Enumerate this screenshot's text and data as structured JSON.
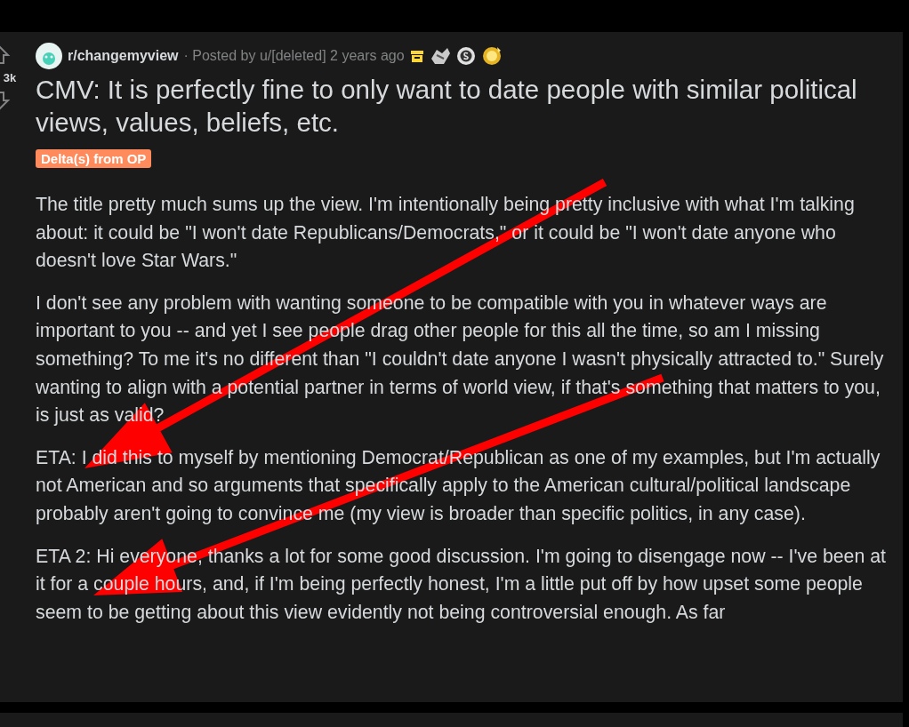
{
  "post": {
    "votes": {
      "count": "3k"
    },
    "subreddit": "r/changemyview",
    "byline": "· Posted by u/[deleted] 2 years ago",
    "awards": [
      {
        "kind": "archived"
      },
      {
        "kind": "handshake"
      },
      {
        "kind": "silver"
      },
      {
        "kind": "gold"
      }
    ],
    "title": "CMV: It is perfectly fine to only want to date people with similar political views, values, beliefs, etc.",
    "flair": "Delta(s) from OP",
    "paragraphs": [
      "The title pretty much sums up the view. I'm intentionally being pretty inclusive with what I'm talking about: it could be \"I won't date Republicans/Democrats,\" or it could be \"I won't date anyone who doesn't love Star Wars.\"",
      "I don't see any problem with wanting someone to be compatible with you in whatever ways are important to you -- and yet I see people drag other people for this all the time, so am I missing something? To me it's no different than \"I couldn't date anyone I wasn't physically attracted to.\" Surely wanting to align with a potential partner in terms of world view, if that's something that matters to you, is just as valid?",
      "ETA: I did this to myself by mentioning Democrat/Republican as one of my examples, but I'm actually not American and so arguments that specifically apply to the American cultural/political landscape probably aren't going to convince me (my view is broader than specific politics, in any case).",
      "ETA 2: Hi everyone, thanks a lot for some good discussion. I'm going to disengage now -- I've been at it for a couple hours, and, if I'm being perfectly honest, I'm a little put off by how upset some people seem to be getting about this view evidently not being controversial enough. As far"
    ]
  },
  "annotations": [
    {
      "kind": "arrow"
    },
    {
      "kind": "arrow"
    }
  ]
}
